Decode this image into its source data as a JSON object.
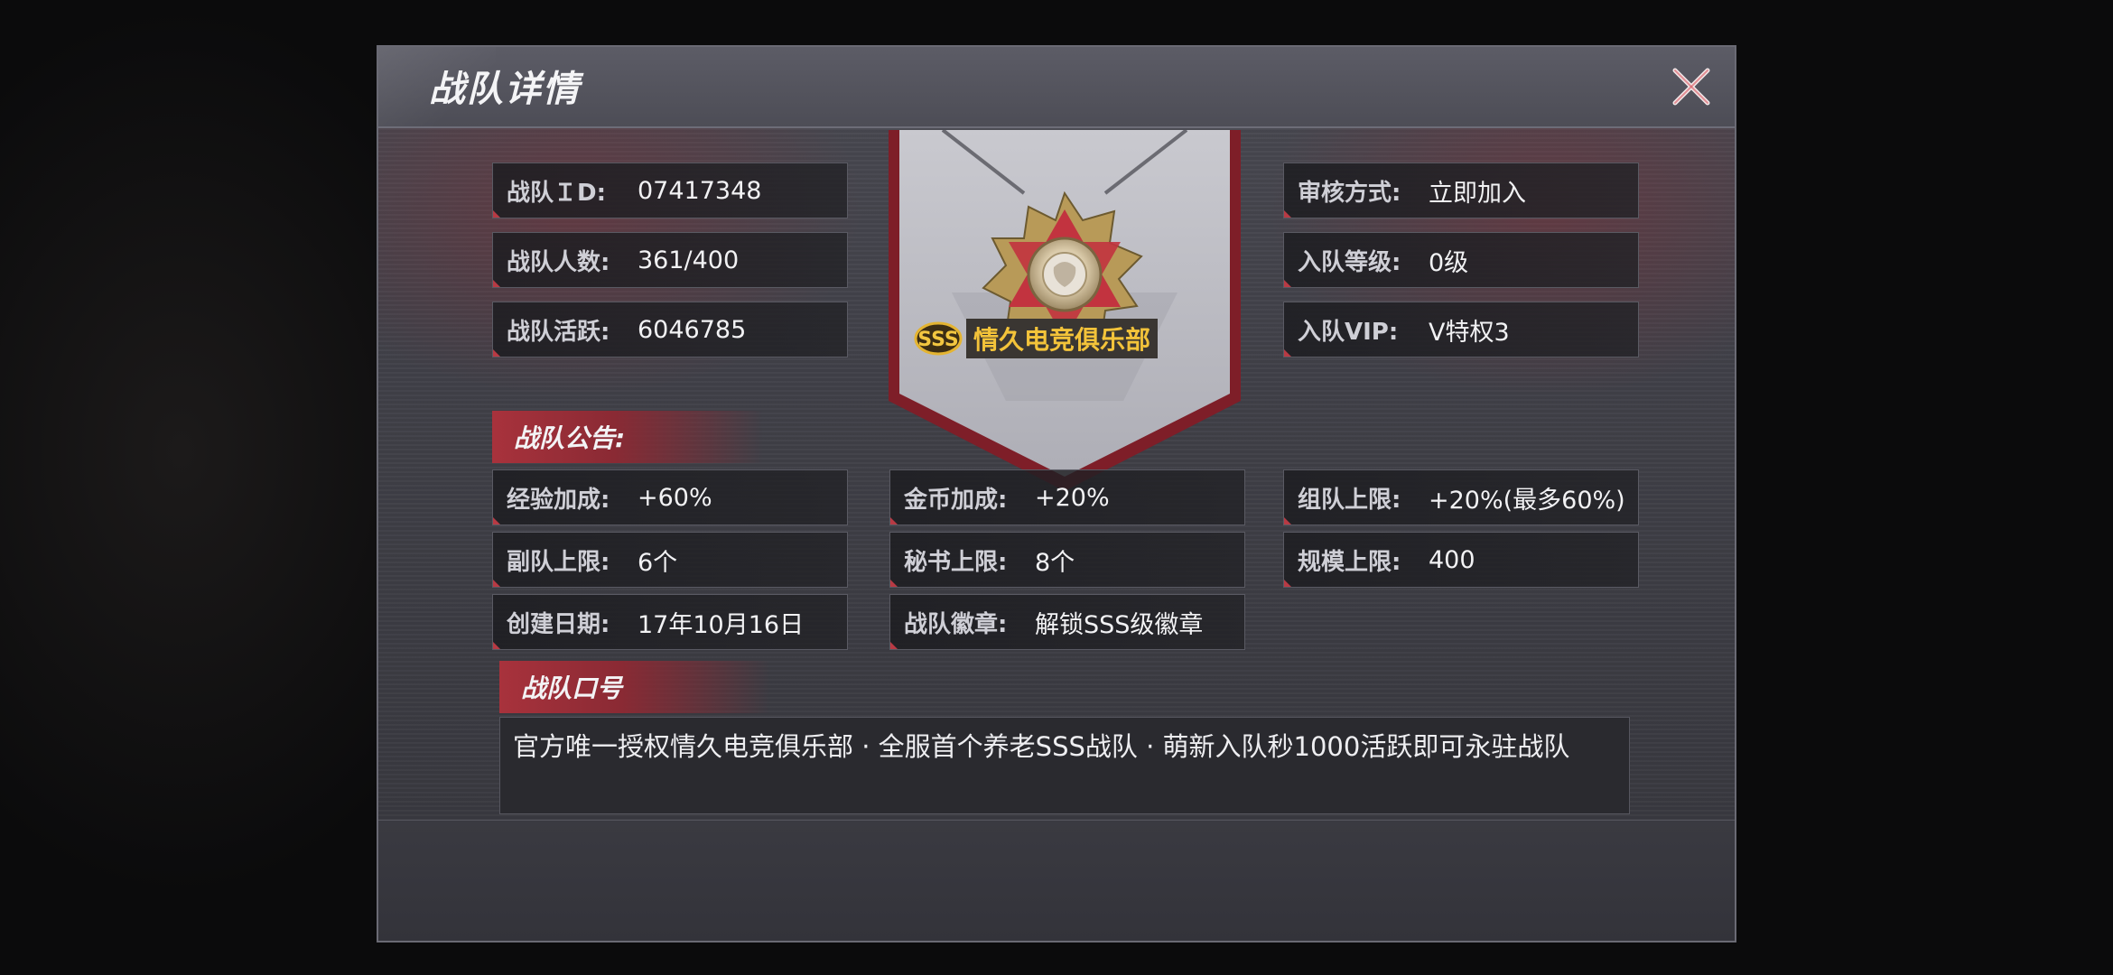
{
  "dialog": {
    "title": "战队详情"
  },
  "info_left": [
    {
      "label": "战队ＩD:",
      "value": "07417348"
    },
    {
      "label": "战队人数:",
      "value": "361/400"
    },
    {
      "label": "战队活跃:",
      "value": "6046785"
    }
  ],
  "info_right": [
    {
      "label": "审核方式:",
      "value": "立即加入"
    },
    {
      "label": "入队等级:",
      "value": "0级"
    },
    {
      "label": "入队VIP:",
      "value": "V特权3"
    }
  ],
  "emblem": {
    "grade_badge": "SSS",
    "team_name": "情久电竞俱乐部"
  },
  "announcement": {
    "header": "战队公告:",
    "col1": [
      {
        "label": "经验加成:",
        "value": "+60%"
      },
      {
        "label": "副队上限:",
        "value": "6个"
      },
      {
        "label": "创建日期:",
        "value": "17年10月16日"
      }
    ],
    "col2": [
      {
        "label": "金币加成:",
        "value": "+20%"
      },
      {
        "label": "秘书上限:",
        "value": "8个"
      },
      {
        "label": "战队徽章:",
        "value": "解锁SSS级徽章"
      }
    ],
    "col3": [
      {
        "label": "组队上限:",
        "value": "+20%(最多60%)"
      },
      {
        "label": "规模上限:",
        "value": "400"
      }
    ]
  },
  "slogan": {
    "header": "战队口号",
    "text": "官方唯一授权情久电竞俱乐部 · 全服首个养老SSS战队 · 萌新入队秒1000活跃即可永驻战队"
  },
  "colors": {
    "accent_red": "#a8323c",
    "gold": "#f3c33a",
    "panel": "#404048"
  }
}
